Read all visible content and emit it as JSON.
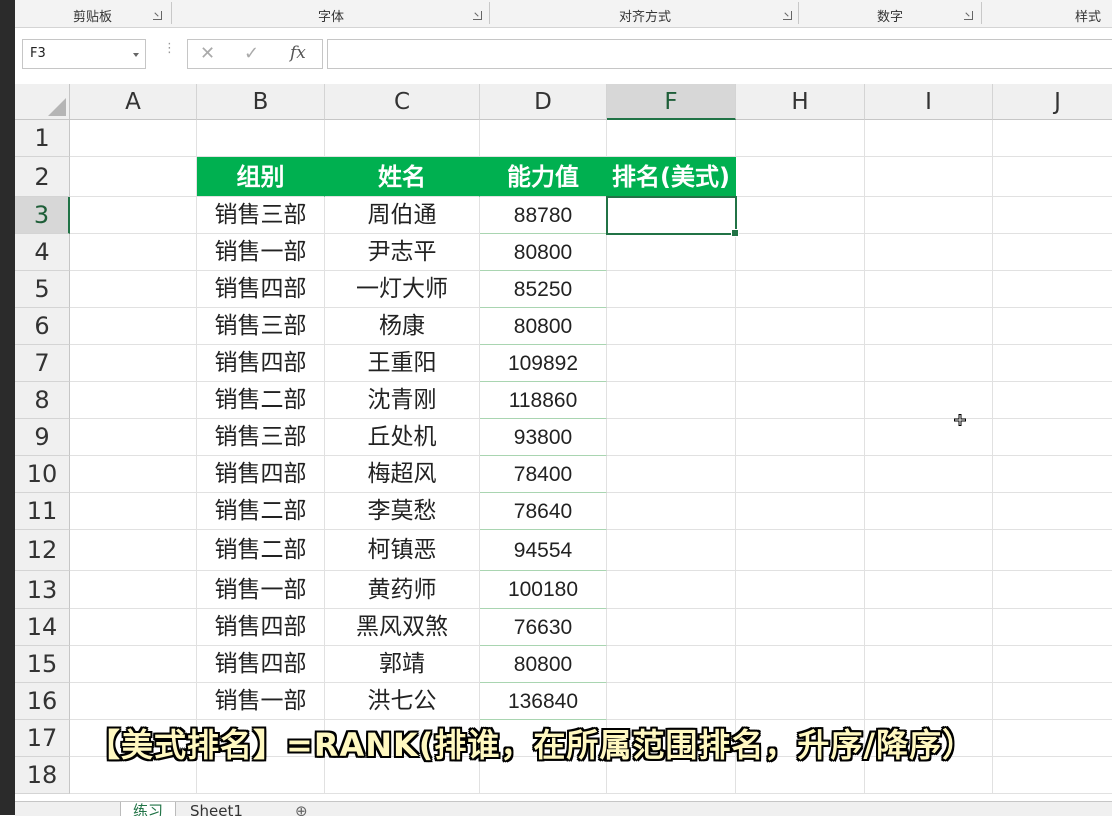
{
  "ribbon": {
    "groups": [
      "剪贴板",
      "字体",
      "对齐方式",
      "数字",
      "样式"
    ]
  },
  "formula_bar": {
    "name_box": "F3",
    "cancel_icon": "✕",
    "enter_icon": "✓",
    "fx_label": "fx",
    "content": ""
  },
  "columns": [
    "A",
    "B",
    "C",
    "D",
    "F",
    "H",
    "I",
    "J"
  ],
  "rows": [
    "1",
    "2",
    "3",
    "4",
    "5",
    "6",
    "7",
    "8",
    "9",
    "10",
    "11",
    "12",
    "13",
    "14",
    "15",
    "16",
    "17",
    "18"
  ],
  "table": {
    "headers": [
      "组别",
      "姓名",
      "能力值",
      "排名(美式)"
    ],
    "rows": [
      {
        "group": "销售三部",
        "name": "周伯通",
        "value": "88780",
        "rank": ""
      },
      {
        "group": "销售一部",
        "name": "尹志平",
        "value": "80800",
        "rank": ""
      },
      {
        "group": "销售四部",
        "name": "一灯大师",
        "value": "85250",
        "rank": ""
      },
      {
        "group": "销售三部",
        "name": "杨康",
        "value": "80800",
        "rank": ""
      },
      {
        "group": "销售四部",
        "name": "王重阳",
        "value": "109892",
        "rank": ""
      },
      {
        "group": "销售二部",
        "name": "沈青刚",
        "value": "118860",
        "rank": ""
      },
      {
        "group": "销售三部",
        "name": "丘处机",
        "value": "93800",
        "rank": ""
      },
      {
        "group": "销售四部",
        "name": "梅超风",
        "value": "78400",
        "rank": ""
      },
      {
        "group": "销售二部",
        "name": "李莫愁",
        "value": "78640",
        "rank": ""
      },
      {
        "group": "销售二部",
        "name": "柯镇恶",
        "value": "94554",
        "rank": ""
      },
      {
        "group": "销售一部",
        "name": "黄药师",
        "value": "100180",
        "rank": ""
      },
      {
        "group": "销售四部",
        "name": "黑风双煞",
        "value": "76630",
        "rank": ""
      },
      {
        "group": "销售四部",
        "name": "郭靖",
        "value": "80800",
        "rank": ""
      },
      {
        "group": "销售一部",
        "name": "洪七公",
        "value": "136840",
        "rank": ""
      }
    ]
  },
  "selected_cell": "F3",
  "sheet_tabs": [
    "练习",
    "Sheet1"
  ],
  "subtitle": "【美式排名】=RANK(排谁，在所属范围排名，升序/降序）",
  "colors": {
    "header_green": "#00b050",
    "selection_green": "#217346"
  }
}
